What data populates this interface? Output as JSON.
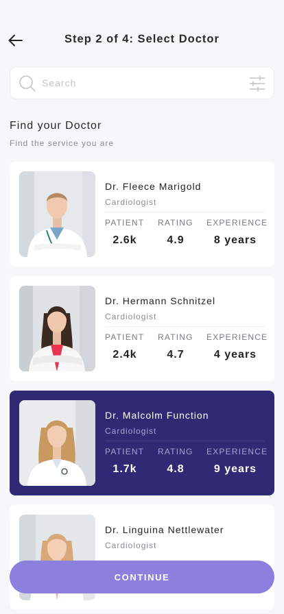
{
  "header": {
    "title": "Step 2 of 4: Select Doctor",
    "back_icon": "arrow-left-icon"
  },
  "search": {
    "placeholder": "Search",
    "value": "",
    "search_icon": "search-icon",
    "filter_icon": "sliders-icon"
  },
  "section": {
    "title": "Find your Doctor",
    "subtitle": "Find the service you are"
  },
  "stat_labels": {
    "patient": "PATIENT",
    "rating": "RATING",
    "experience": "EXPERIENCE"
  },
  "doctors": [
    {
      "name": "Dr. Fleece Marigold",
      "specialty": "Cardiologist",
      "patient": "2.6k",
      "rating": "4.9",
      "experience": "8 years",
      "selected": false
    },
    {
      "name": "Dr. Hermann Schnitzel",
      "specialty": "Cardiologist",
      "patient": "2.4k",
      "rating": "4.7",
      "experience": "4 years",
      "selected": false
    },
    {
      "name": "Dr. Malcolm Function",
      "specialty": "Cardiologist",
      "patient": "1.7k",
      "rating": "4.8",
      "experience": "9 years",
      "selected": true
    },
    {
      "name": "Dr. Linguina Nettlewater",
      "specialty": "Cardiologist",
      "patient": "",
      "rating": "",
      "experience": "",
      "selected": false
    }
  ],
  "footer": {
    "continue_label": "CONTINUE"
  },
  "colors": {
    "accent": "#2f2a73",
    "button": "#8b80dd",
    "background": "#f7f7f9"
  }
}
